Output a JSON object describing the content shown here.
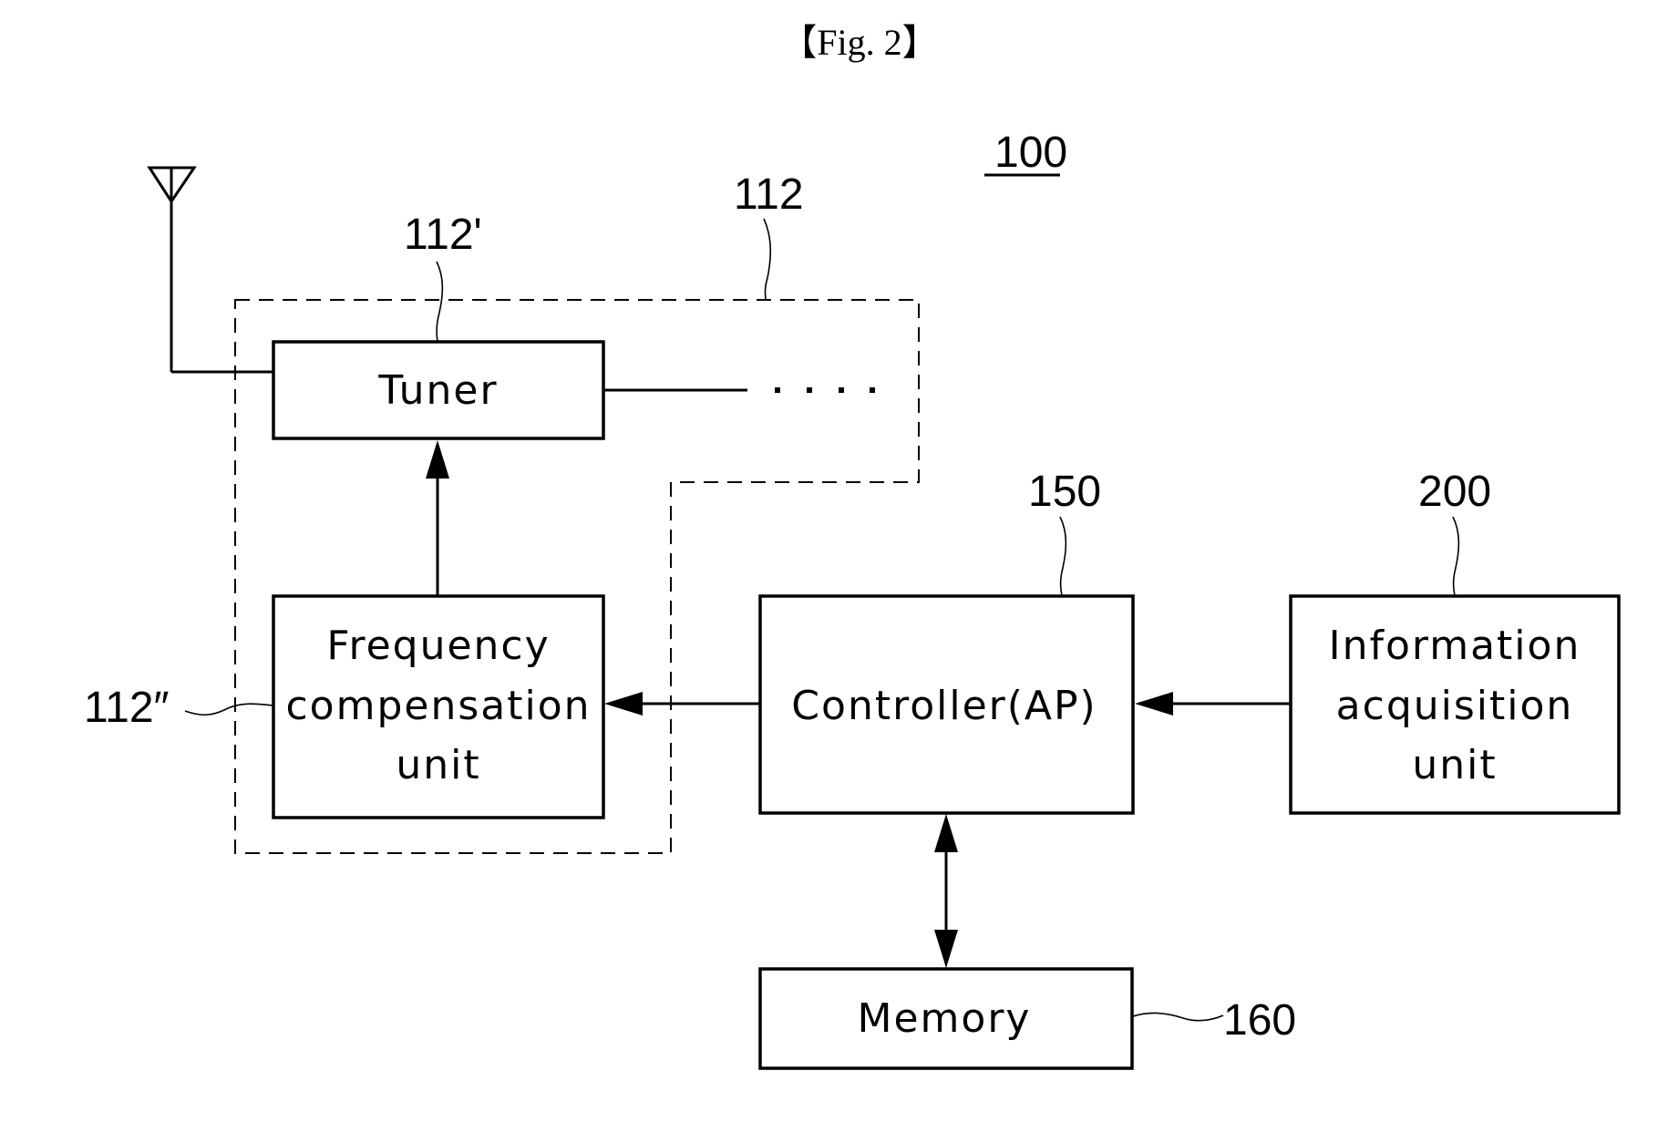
{
  "figure": {
    "title": "【Fig. 2】",
    "system_ref": "100"
  },
  "blocks": {
    "tuner": {
      "label": [
        "Tuner"
      ],
      "ref": "112'"
    },
    "frequency_compensation": {
      "label": [
        "Frequency",
        "compensation",
        "unit"
      ],
      "ref": "112″"
    },
    "controller": {
      "label": [
        "Controller(AP)"
      ],
      "ref": "150"
    },
    "information_acquisition": {
      "label": [
        "Information",
        "acquisition",
        "unit"
      ],
      "ref": "200"
    },
    "memory": {
      "label": [
        "Memory"
      ],
      "ref": "160"
    }
  },
  "groups": {
    "receiver_group": {
      "ref": "112"
    }
  },
  "connections": [
    {
      "from": "antenna",
      "to": "tuner",
      "type": "line"
    },
    {
      "from": "tuner",
      "to": "more-tuners",
      "type": "line-ellipsis"
    },
    {
      "from": "frequency_compensation",
      "to": "tuner",
      "type": "arrow"
    },
    {
      "from": "controller",
      "to": "frequency_compensation",
      "type": "arrow"
    },
    {
      "from": "information_acquisition",
      "to": "controller",
      "type": "arrow"
    },
    {
      "from": "controller",
      "to": "memory",
      "type": "bidirectional-arrow"
    }
  ]
}
